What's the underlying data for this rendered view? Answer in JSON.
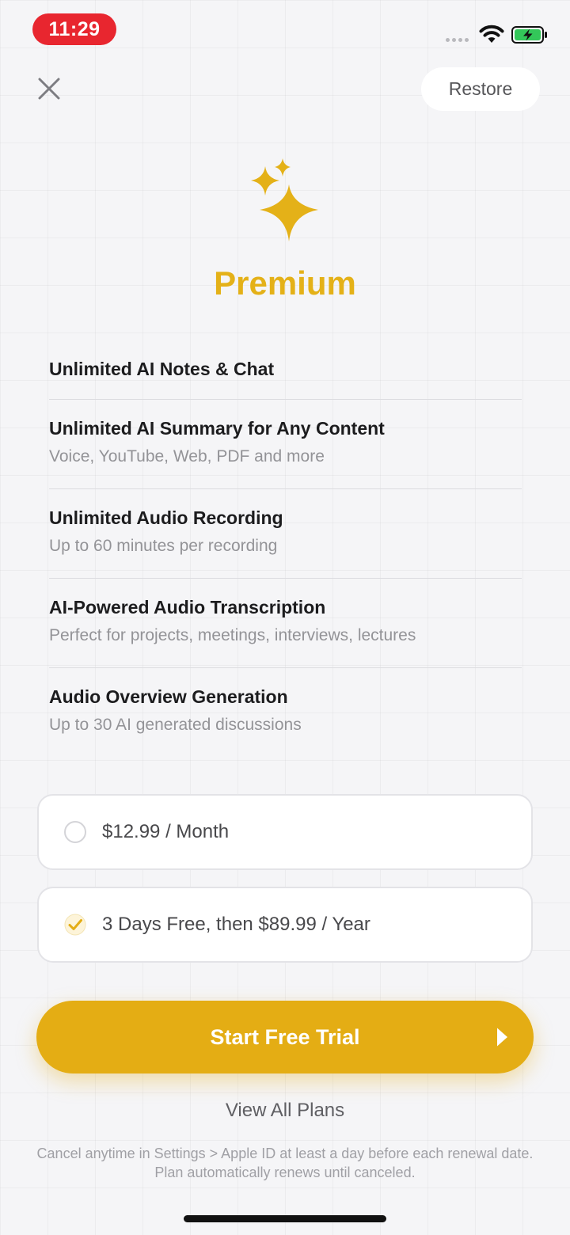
{
  "status_bar": {
    "time": "11:29",
    "icons": [
      "signal-icon",
      "wifi-icon",
      "battery-charging-icon"
    ],
    "time_badge_color": "#e8262f"
  },
  "header": {
    "close_icon": "close-icon",
    "restore_label": "Restore"
  },
  "hero": {
    "icon": "sparkles-icon",
    "title": "Premium",
    "accent_color": "#e4b118"
  },
  "features": [
    {
      "title": "Unlimited AI Notes & Chat",
      "subtitle": ""
    },
    {
      "title": "Unlimited AI Summary for Any Content",
      "subtitle": "Voice, YouTube, Web, PDF and more"
    },
    {
      "title": "Unlimited Audio Recording",
      "subtitle": "Up to 60 minutes per recording"
    },
    {
      "title": "AI-Powered Audio Transcription",
      "subtitle": "Perfect for projects, meetings, interviews, lectures"
    },
    {
      "title": "Audio Overview Generation",
      "subtitle": "Up to 30 AI generated discussions"
    }
  ],
  "plans": [
    {
      "label": "$12.99 / Month",
      "selected": false
    },
    {
      "label": "3 Days Free, then $89.99 / Year",
      "selected": true
    }
  ],
  "cta": {
    "label": "Start Free Trial",
    "icon": "play-arrow-icon",
    "color": "#e4ad14"
  },
  "view_all_plans": "View All Plans",
  "legal_text": "Cancel anytime in Settings > Apple ID at least a day before each renewal date. Plan automatically renews until canceled."
}
